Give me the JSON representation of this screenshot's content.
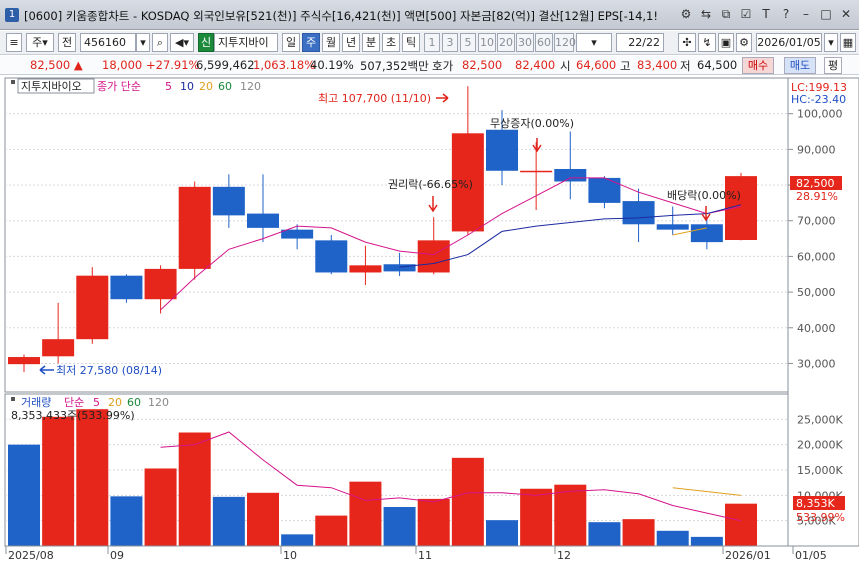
{
  "window": {
    "badge": "1",
    "title": "[0600] 키움종합차트 - KOSDAQ 외국인보유[521(천)] 주식수[16,421(천)] 액면[500] 자본금[82(억)] 결산[12월] EPS[-14,1!"
  },
  "toolbar": {
    "period_label": "주",
    "whole_label": "전",
    "code": "456160",
    "new_badge": "신",
    "stock_name": "지투지바이",
    "day": "일",
    "week": "주",
    "month": "월",
    "year": "년",
    "minute": "분",
    "second": "초",
    "tick": "틱",
    "n1": "1",
    "n3": "3",
    "n5": "5",
    "n10": "10",
    "n20": "20",
    "n30": "30",
    "n60": "60",
    "n120": "120",
    "page": "22",
    "page_total": "/22",
    "date": "2026/01/05"
  },
  "quote": {
    "price": "82,500",
    "change": "18,000",
    "change_pct": "+27.91%",
    "volume": "6,599,462",
    "volume_pct": "1,063.18%",
    "turnover_pct": "40.19%",
    "amount": "507,352백만",
    "ask_label": "호가",
    "ask1": "82,500",
    "ask2": "82,400",
    "open_label": "시",
    "open": "64,600",
    "high_label": "고",
    "high": "83,400",
    "low_label": "저",
    "low": "64,500",
    "buy": "매수",
    "sell": "매도",
    "eval": "평"
  },
  "colors": {
    "up": "#e6261a",
    "down": "#1f63c9",
    "ma5": "#d4148a",
    "ma10": "#1c2aa0",
    "ma20": "#e0a020"
  },
  "price_panel": {
    "legend": {
      "name": "지투지바이오",
      "ma_label": "종가 단순",
      "p5": "5",
      "p10": "10",
      "p20": "20",
      "p60": "60",
      "p120": "120"
    },
    "lc": "LC:199.13",
    "hc": "HC:-23.40",
    "current_price": "82,500",
    "current_pct": "28.91%",
    "annotations": {
      "high": "최고 107,700 (11/10)",
      "low": "최저 27,580 (08/14)",
      "rights": "권리락(-66.65%)",
      "bonus": "무상증자(0.00%)",
      "dividend": "배당락(0.00%)"
    }
  },
  "volume_panel": {
    "legend": {
      "name": "거래량",
      "ma_label": "단순",
      "p5": "5",
      "p20": "20",
      "p60": "60",
      "p120": "120"
    },
    "summary": "8,353,433주(533.99%)",
    "current": "8,353K",
    "current_pct": "533.99%"
  },
  "x_axis": [
    "2025/08",
    "09",
    "10",
    "11",
    "12",
    "2026/01",
    "01/05"
  ],
  "chart_data": {
    "type": "candlestick",
    "y_ticks": [
      "100,000",
      "90,000",
      "80,000",
      "70,000",
      "60,000",
      "50,000",
      "40,000",
      "30,000"
    ],
    "price_ylim": [
      22000,
      110000
    ],
    "volume_ticks": [
      "25,000K",
      "20,000K",
      "15,000K",
      "10,000K",
      "5,000K"
    ],
    "volume_ylim": [
      0,
      30000
    ],
    "candles": [
      {
        "o": 29800,
        "h": 32500,
        "l": 27580,
        "c": 31800,
        "up": true
      },
      {
        "o": 32000,
        "h": 47000,
        "l": 30000,
        "c": 36800,
        "up": true
      },
      {
        "o": 36800,
        "h": 57000,
        "l": 35500,
        "c": 54600,
        "up": true
      },
      {
        "o": 54600,
        "h": 55000,
        "l": 47000,
        "c": 48000,
        "up": false
      },
      {
        "o": 48000,
        "h": 57500,
        "l": 44000,
        "c": 56500,
        "up": true
      },
      {
        "o": 56500,
        "h": 81000,
        "l": 53500,
        "c": 79500,
        "up": true
      },
      {
        "o": 79500,
        "h": 83000,
        "l": 68000,
        "c": 71500,
        "up": false
      },
      {
        "o": 72000,
        "h": 83000,
        "l": 64000,
        "c": 68000,
        "up": false
      },
      {
        "o": 67500,
        "h": 69000,
        "l": 62000,
        "c": 65000,
        "up": false
      },
      {
        "o": 64500,
        "h": 66000,
        "l": 55000,
        "c": 55500,
        "up": false
      },
      {
        "o": 55500,
        "h": 63000,
        "l": 52000,
        "c": 57500,
        "up": true
      },
      {
        "o": 55800,
        "h": 61000,
        "l": 54500,
        "c": 57800,
        "up": false
      },
      {
        "o": 55500,
        "h": 71000,
        "l": 55000,
        "c": 64500,
        "up": true
      },
      {
        "o": 67000,
        "h": 107700,
        "l": 66000,
        "c": 94500,
        "up": true
      },
      {
        "o": 95500,
        "h": 101000,
        "l": 80000,
        "c": 84000,
        "up": false
      },
      {
        "o": 84000,
        "h": 92000,
        "l": 73000,
        "c": 84000,
        "up": true
      },
      {
        "o": 84500,
        "h": 95000,
        "l": 76000,
        "c": 81000,
        "up": false
      },
      {
        "o": 82000,
        "h": 82500,
        "l": 73500,
        "c": 75000,
        "up": false
      },
      {
        "o": 75500,
        "h": 79000,
        "l": 64000,
        "c": 69000,
        "up": false
      },
      {
        "o": 69000,
        "h": 74000,
        "l": 66000,
        "c": 67500,
        "up": false
      },
      {
        "o": 69000,
        "h": 71000,
        "l": 62000,
        "c": 64000,
        "up": false
      },
      {
        "o": 64600,
        "h": 83400,
        "l": 64500,
        "c": 82500,
        "up": true
      }
    ],
    "ma5": [
      null,
      null,
      null,
      null,
      45000,
      54000,
      62000,
      65000,
      68500,
      68000,
      64000,
      61500,
      60500,
      66000,
      72000,
      77000,
      82000,
      82000,
      78000,
      75000,
      72000,
      74000
    ],
    "ma10": [
      null,
      null,
      null,
      null,
      null,
      null,
      null,
      null,
      null,
      null,
      null,
      57000,
      58000,
      60500,
      67000,
      68500,
      69500,
      70500,
      70800,
      71500,
      72000,
      74500
    ],
    "volume": [
      {
        "v": 20000,
        "up": false
      },
      {
        "v": 25500,
        "up": true
      },
      {
        "v": 27000,
        "up": true
      },
      {
        "v": 9800,
        "up": false
      },
      {
        "v": 15300,
        "up": true
      },
      {
        "v": 22400,
        "up": true
      },
      {
        "v": 9700,
        "up": false
      },
      {
        "v": 10500,
        "up": true
      },
      {
        "v": 2300,
        "up": false
      },
      {
        "v": 6000,
        "up": true
      },
      {
        "v": 12700,
        "up": true
      },
      {
        "v": 7700,
        "up": false
      },
      {
        "v": 9300,
        "up": true
      },
      {
        "v": 17400,
        "up": true
      },
      {
        "v": 5100,
        "up": false
      },
      {
        "v": 11300,
        "up": true
      },
      {
        "v": 12100,
        "up": true
      },
      {
        "v": 4700,
        "up": false
      },
      {
        "v": 5300,
        "up": true
      },
      {
        "v": 3000,
        "up": false
      },
      {
        "v": 1800,
        "up": false
      },
      {
        "v": 8353,
        "up": true
      }
    ],
    "vol_ma5": [
      null,
      null,
      null,
      null,
      19500,
      20000,
      22500,
      17000,
      12000,
      11500,
      9000,
      9500,
      8700,
      10500,
      10500,
      10000,
      10800,
      11100,
      10300,
      8000,
      6500,
      5000
    ]
  }
}
